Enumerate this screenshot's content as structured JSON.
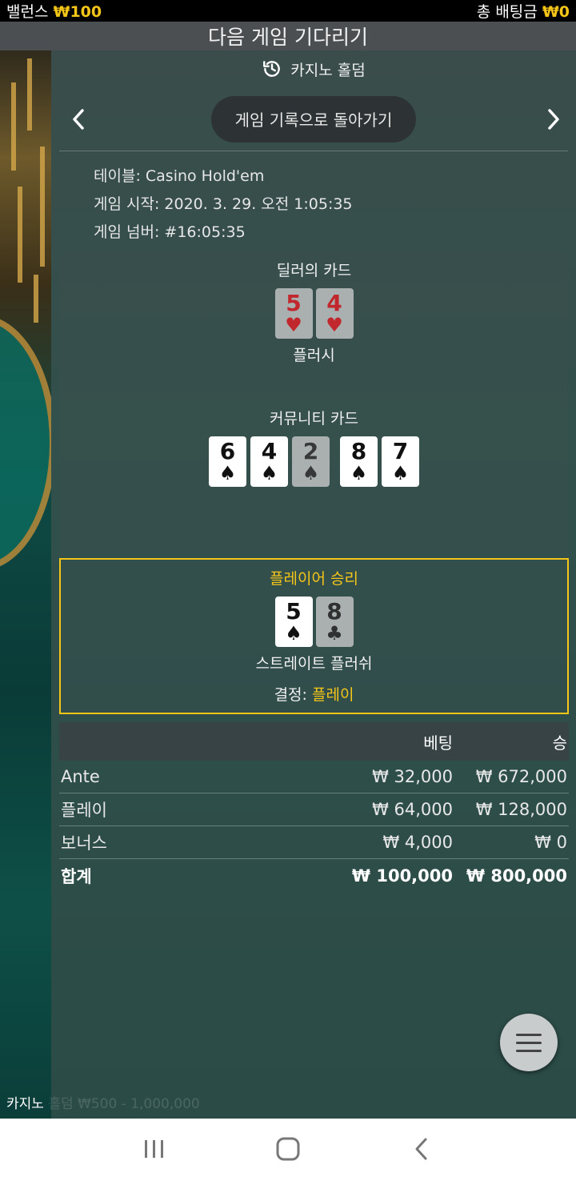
{
  "status": {
    "balance_label": "밸런스",
    "balance_value": "₩100",
    "total_bet_label": "총 배팅금",
    "total_bet_value": "₩0"
  },
  "title": "다음 게임 기다리기",
  "panel": {
    "header": "카지노 홀덤",
    "back_button": "게임 기록으로 돌아가기",
    "info": {
      "table_label": "테이블:",
      "table_value": "Casino Hold'em",
      "start_label": "게임 시작:",
      "start_value": "2020. 3. 29. 오전 1:05:35",
      "number_label": "게임 넘버:",
      "number_value": "#16:05:35"
    }
  },
  "dealer": {
    "label": "딜러의 카드",
    "cards": [
      {
        "rank": "5",
        "suit": "♥",
        "color": "red"
      },
      {
        "rank": "4",
        "suit": "♥",
        "color": "red"
      }
    ],
    "hand": "플러시"
  },
  "community": {
    "label": "커뮤니티 카드",
    "cards": [
      {
        "rank": "6",
        "suit": "♠",
        "color": "black"
      },
      {
        "rank": "4",
        "suit": "♠",
        "color": "black"
      },
      {
        "rank": "2",
        "suit": "♠",
        "color": "black"
      },
      {
        "rank": "8",
        "suit": "♠",
        "color": "black"
      },
      {
        "rank": "7",
        "suit": "♠",
        "color": "black"
      }
    ]
  },
  "player": {
    "title": "플레이어 승리",
    "cards": [
      {
        "rank": "5",
        "suit": "♠",
        "color": "black"
      },
      {
        "rank": "8",
        "suit": "♣",
        "color": "black"
      }
    ],
    "hand": "스트레이트 플러쉬",
    "decision_label": "결정:",
    "decision_value": "플레이"
  },
  "bets": {
    "col_bet": "베팅",
    "col_win": "승",
    "rows": [
      {
        "name": "Ante",
        "bet": "₩ 32,000",
        "win": "₩ 672,000"
      },
      {
        "name": "플레이",
        "bet": "₩ 64,000",
        "win": "₩ 128,000"
      },
      {
        "name": "보너스",
        "bet": "₩ 4,000",
        "win": "₩ 0"
      }
    ],
    "total": {
      "name": "합계",
      "bet": "₩ 100,000",
      "win": "₩ 800,000"
    }
  },
  "footer_caption": "카지노",
  "footer_caption_faded": "홀덤 ₩500 - 1,000,000",
  "icons": {
    "history": "history-icon",
    "menu": "hamburger-menu-icon"
  },
  "colors": {
    "gold": "#f5c518",
    "panel": "#31504c",
    "heart": "#c0282d"
  }
}
